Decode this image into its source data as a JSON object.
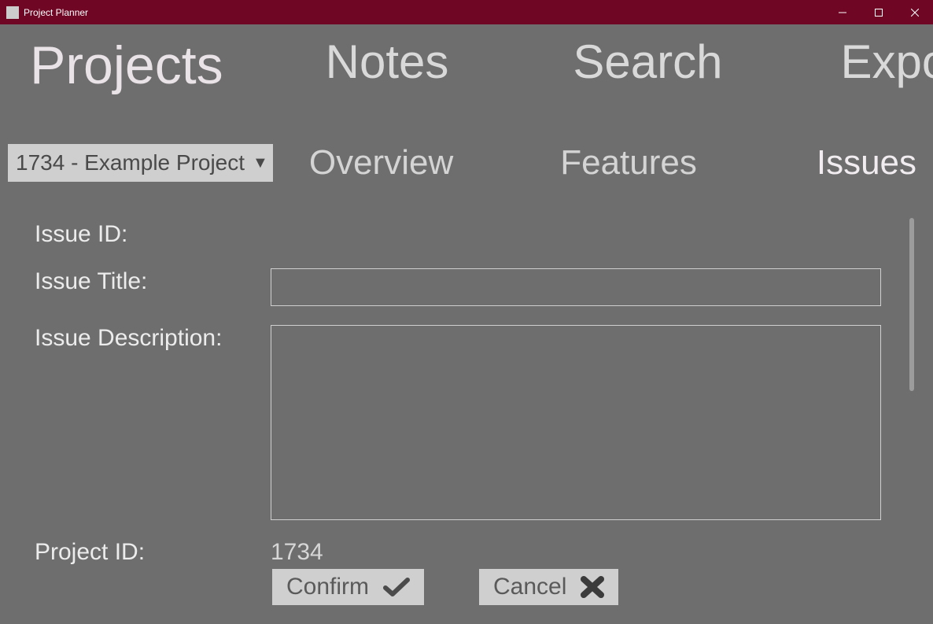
{
  "window": {
    "title": "Project Planner"
  },
  "toptabs": {
    "projects": "Projects",
    "notes": "Notes",
    "search": "Search",
    "export": "Export"
  },
  "projectSelect": {
    "label": "1734 - Example Project"
  },
  "subtabs": {
    "overview": "Overview",
    "features": "Features",
    "issues": "Issues"
  },
  "form": {
    "issue_id_label": "Issue ID:",
    "issue_id_value": "",
    "issue_title_label": "Issue Title:",
    "issue_title_value": "",
    "issue_desc_label": "Issue Description:",
    "issue_desc_value": "",
    "project_id_label": "Project ID:",
    "project_id_value": "1734"
  },
  "buttons": {
    "confirm": "Confirm",
    "cancel": "Cancel"
  }
}
